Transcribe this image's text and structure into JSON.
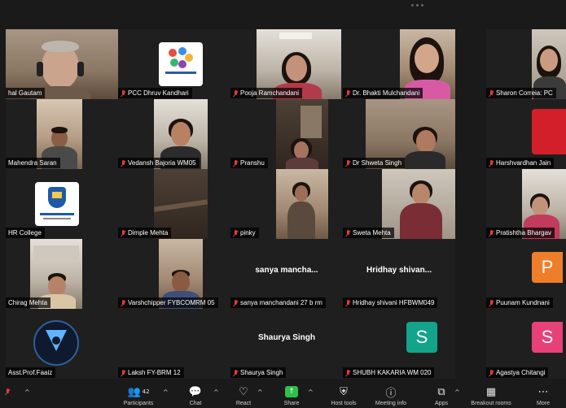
{
  "toolbar": {
    "participants_label": "Participants",
    "participants_count": "42",
    "chat_label": "Chat",
    "react_label": "React",
    "share_label": "Share",
    "host_tools_label": "Host tools",
    "meeting_info_label": "Meeting info",
    "apps_label": "Apps",
    "breakout_label": "Breakout rooms",
    "more_label": "More",
    "caret": "^"
  },
  "participants": [
    {
      "name": "hal Gautam",
      "muted": false,
      "active": true
    },
    {
      "name": "PCC Dhruv Kandhari",
      "muted": true
    },
    {
      "name": "Pooja Ramchandani",
      "muted": true
    },
    {
      "name": "Dr. Bhakti Mulchandani",
      "muted": true
    },
    {
      "name": "Sharon Correia: PC",
      "muted": true
    },
    {
      "name": "Mahendra Saran",
      "muted": false
    },
    {
      "name": "Vedansh Bajoria WM05",
      "muted": true
    },
    {
      "name": "Pranshu",
      "muted": true
    },
    {
      "name": "Dr Shweta Singh",
      "muted": true
    },
    {
      "name": "Harshvardhan Jain",
      "muted": true
    },
    {
      "name": "HR College",
      "muted": false
    },
    {
      "name": "Dimple Mehta",
      "muted": true
    },
    {
      "name": "pinky",
      "muted": true
    },
    {
      "name": "Sweta Mehta",
      "muted": true
    },
    {
      "name": "Pratishtha Bhargav",
      "muted": true
    },
    {
      "name": "Chirag Mehta",
      "muted": false
    },
    {
      "name": "Varshchipper FYBCOMRM 05",
      "muted": true
    },
    {
      "name": "sanya manchandani 27 b rm",
      "muted": true,
      "display": "sanya mancha..."
    },
    {
      "name": "Hridhay shivani HFBWM049",
      "muted": true,
      "display": "Hridhay shivan..."
    },
    {
      "name": "Puunam Kundnani",
      "muted": true,
      "avatar": "P",
      "avatar_color": "#ef7e2a"
    },
    {
      "name": "Asst.Prof.Faaiz",
      "muted": false
    },
    {
      "name": "Laksh FY-BRM 12",
      "muted": true
    },
    {
      "name": "Shaurya Singh",
      "muted": true,
      "display": "Shaurya Singh"
    },
    {
      "name": "SHUBH KAKARIA WM 020",
      "muted": true,
      "avatar": "S",
      "avatar_color": "#14a38b"
    },
    {
      "name": "Agastya Chitangi",
      "muted": true,
      "avatar": "S",
      "avatar_color": "#e8417a"
    }
  ],
  "colors": {
    "active_speaker": "#3ecf3e",
    "muted_mic": "#e23a3a",
    "share_button": "#2fbf4a"
  }
}
